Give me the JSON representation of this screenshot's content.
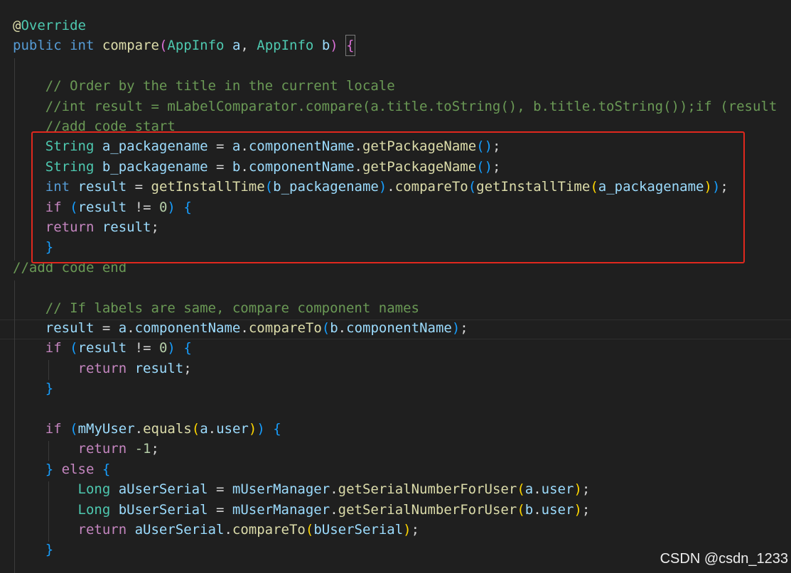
{
  "colors": {
    "background": "#1f1f1f",
    "keyword": "#569cd6",
    "control": "#c586c0",
    "type": "#4ec9b0",
    "function": "#dcdcaa",
    "variable": "#9cdcfe",
    "comment": "#6a9955",
    "number": "#b5cea8",
    "plain": "#d4d4d4",
    "bracket1": "#ffd700",
    "bracket2": "#da70d6",
    "bracket3": "#179fff",
    "annotation": "#dcdcaa",
    "highlight_border": "#e0281e"
  },
  "code_lines": [
    [
      [
        "@",
        "annotation"
      ],
      [
        "Override",
        "type"
      ]
    ],
    [
      [
        "public",
        "keyword"
      ],
      [
        " ",
        "plain"
      ],
      [
        "int",
        "keyword"
      ],
      [
        " ",
        "plain"
      ],
      [
        "compare",
        "function"
      ],
      [
        "(",
        "bracket2"
      ],
      [
        "AppInfo",
        "type"
      ],
      [
        " ",
        "plain"
      ],
      [
        "a",
        "variable"
      ],
      [
        ", ",
        "plain"
      ],
      [
        "AppInfo",
        "type"
      ],
      [
        " ",
        "plain"
      ],
      [
        "b",
        "variable"
      ],
      [
        ")",
        "bracket2"
      ],
      [
        " ",
        "plain"
      ],
      [
        "{",
        "bracket2box"
      ]
    ],
    [],
    [
      [
        "    // Order by the title in the current locale",
        "comment"
      ]
    ],
    [
      [
        "    //int result = mLabelComparator.compare(a.title.toString(), b.title.toString());if (result",
        "comment"
      ]
    ],
    [
      [
        "    //add code start",
        "comment"
      ]
    ],
    [
      [
        "    ",
        "plain"
      ],
      [
        "String",
        "type"
      ],
      [
        " ",
        "plain"
      ],
      [
        "a_packagename",
        "variable"
      ],
      [
        " = ",
        "plain"
      ],
      [
        "a",
        "variable"
      ],
      [
        ".",
        "plain"
      ],
      [
        "componentName",
        "variable"
      ],
      [
        ".",
        "plain"
      ],
      [
        "getPackageName",
        "function"
      ],
      [
        "()",
        "bracket3"
      ],
      [
        ";",
        "plain"
      ]
    ],
    [
      [
        "    ",
        "plain"
      ],
      [
        "String",
        "type"
      ],
      [
        " ",
        "plain"
      ],
      [
        "b_packagename",
        "variable"
      ],
      [
        " = ",
        "plain"
      ],
      [
        "b",
        "variable"
      ],
      [
        ".",
        "plain"
      ],
      [
        "componentName",
        "variable"
      ],
      [
        ".",
        "plain"
      ],
      [
        "getPackageName",
        "function"
      ],
      [
        "()",
        "bracket3"
      ],
      [
        ";",
        "plain"
      ]
    ],
    [
      [
        "    ",
        "plain"
      ],
      [
        "int",
        "keyword"
      ],
      [
        " ",
        "plain"
      ],
      [
        "result",
        "variable"
      ],
      [
        " = ",
        "plain"
      ],
      [
        "getInstallTime",
        "function"
      ],
      [
        "(",
        "bracket3"
      ],
      [
        "b_packagename",
        "variable"
      ],
      [
        ")",
        "bracket3"
      ],
      [
        ".",
        "plain"
      ],
      [
        "compareTo",
        "function"
      ],
      [
        "(",
        "bracket3"
      ],
      [
        "getInstallTime",
        "function"
      ],
      [
        "(",
        "bracket1"
      ],
      [
        "a_packagename",
        "variable"
      ],
      [
        ")",
        "bracket1"
      ],
      [
        ")",
        "bracket3"
      ],
      [
        ";",
        "plain"
      ]
    ],
    [
      [
        "    ",
        "plain"
      ],
      [
        "if",
        "control"
      ],
      [
        " ",
        "plain"
      ],
      [
        "(",
        "bracket3"
      ],
      [
        "result",
        "variable"
      ],
      [
        " != ",
        "plain"
      ],
      [
        "0",
        "number"
      ],
      [
        ")",
        "bracket3"
      ],
      [
        " ",
        "plain"
      ],
      [
        "{",
        "bracket3"
      ]
    ],
    [
      [
        "    ",
        "plain"
      ],
      [
        "return",
        "control"
      ],
      [
        " ",
        "plain"
      ],
      [
        "result",
        "variable"
      ],
      [
        ";",
        "plain"
      ]
    ],
    [
      [
        "    ",
        "plain"
      ],
      [
        "}",
        "bracket3"
      ]
    ],
    [
      [
        "//add code end",
        "comment"
      ]
    ],
    [],
    [
      [
        "    // If labels are same, compare component names",
        "comment"
      ]
    ],
    [
      [
        "    ",
        "plain"
      ],
      [
        "result",
        "variable"
      ],
      [
        " = ",
        "plain"
      ],
      [
        "a",
        "variable"
      ],
      [
        ".",
        "plain"
      ],
      [
        "componentName",
        "variable"
      ],
      [
        ".",
        "plain"
      ],
      [
        "compareTo",
        "function"
      ],
      [
        "(",
        "bracket3"
      ],
      [
        "b",
        "variable"
      ],
      [
        ".",
        "plain"
      ],
      [
        "componentName",
        "variable"
      ],
      [
        ")",
        "bracket3"
      ],
      [
        ";",
        "plain"
      ]
    ],
    [
      [
        "    ",
        "plain"
      ],
      [
        "if",
        "control"
      ],
      [
        " ",
        "plain"
      ],
      [
        "(",
        "bracket3"
      ],
      [
        "result",
        "variable"
      ],
      [
        " != ",
        "plain"
      ],
      [
        "0",
        "number"
      ],
      [
        ")",
        "bracket3"
      ],
      [
        " ",
        "plain"
      ],
      [
        "{",
        "bracket3"
      ]
    ],
    [
      [
        "        ",
        "plain"
      ],
      [
        "return",
        "control"
      ],
      [
        " ",
        "plain"
      ],
      [
        "result",
        "variable"
      ],
      [
        ";",
        "plain"
      ]
    ],
    [
      [
        "    ",
        "plain"
      ],
      [
        "}",
        "bracket3"
      ]
    ],
    [],
    [
      [
        "    ",
        "plain"
      ],
      [
        "if",
        "control"
      ],
      [
        " ",
        "plain"
      ],
      [
        "(",
        "bracket3"
      ],
      [
        "mMyUser",
        "variable"
      ],
      [
        ".",
        "plain"
      ],
      [
        "equals",
        "function"
      ],
      [
        "(",
        "bracket1"
      ],
      [
        "a",
        "variable"
      ],
      [
        ".",
        "plain"
      ],
      [
        "user",
        "variable"
      ],
      [
        ")",
        "bracket1"
      ],
      [
        ")",
        "bracket3"
      ],
      [
        " ",
        "plain"
      ],
      [
        "{",
        "bracket3"
      ]
    ],
    [
      [
        "        ",
        "plain"
      ],
      [
        "return",
        "control"
      ],
      [
        " ",
        "plain"
      ],
      [
        "-1",
        "number"
      ],
      [
        ";",
        "plain"
      ]
    ],
    [
      [
        "    ",
        "plain"
      ],
      [
        "}",
        "bracket3"
      ],
      [
        " ",
        "plain"
      ],
      [
        "else",
        "control"
      ],
      [
        " ",
        "plain"
      ],
      [
        "{",
        "bracket3"
      ]
    ],
    [
      [
        "        ",
        "plain"
      ],
      [
        "Long",
        "type"
      ],
      [
        " ",
        "plain"
      ],
      [
        "aUserSerial",
        "variable"
      ],
      [
        " = ",
        "plain"
      ],
      [
        "mUserManager",
        "variable"
      ],
      [
        ".",
        "plain"
      ],
      [
        "getSerialNumberForUser",
        "function"
      ],
      [
        "(",
        "bracket1"
      ],
      [
        "a",
        "variable"
      ],
      [
        ".",
        "plain"
      ],
      [
        "user",
        "variable"
      ],
      [
        ")",
        "bracket1"
      ],
      [
        ";",
        "plain"
      ]
    ],
    [
      [
        "        ",
        "plain"
      ],
      [
        "Long",
        "type"
      ],
      [
        " ",
        "plain"
      ],
      [
        "bUserSerial",
        "variable"
      ],
      [
        " = ",
        "plain"
      ],
      [
        "mUserManager",
        "variable"
      ],
      [
        ".",
        "plain"
      ],
      [
        "getSerialNumberForUser",
        "function"
      ],
      [
        "(",
        "bracket1"
      ],
      [
        "b",
        "variable"
      ],
      [
        ".",
        "plain"
      ],
      [
        "user",
        "variable"
      ],
      [
        ")",
        "bracket1"
      ],
      [
        ";",
        "plain"
      ]
    ],
    [
      [
        "        ",
        "plain"
      ],
      [
        "return",
        "control"
      ],
      [
        " ",
        "plain"
      ],
      [
        "aUserSerial",
        "variable"
      ],
      [
        ".",
        "plain"
      ],
      [
        "compareTo",
        "function"
      ],
      [
        "(",
        "bracket1"
      ],
      [
        "bUserSerial",
        "variable"
      ],
      [
        ")",
        "bracket1"
      ],
      [
        ";",
        "plain"
      ]
    ],
    [
      [
        "    ",
        "plain"
      ],
      [
        "}",
        "bracket3"
      ]
    ]
  ],
  "watermark": "CSDN @csdn_1233"
}
